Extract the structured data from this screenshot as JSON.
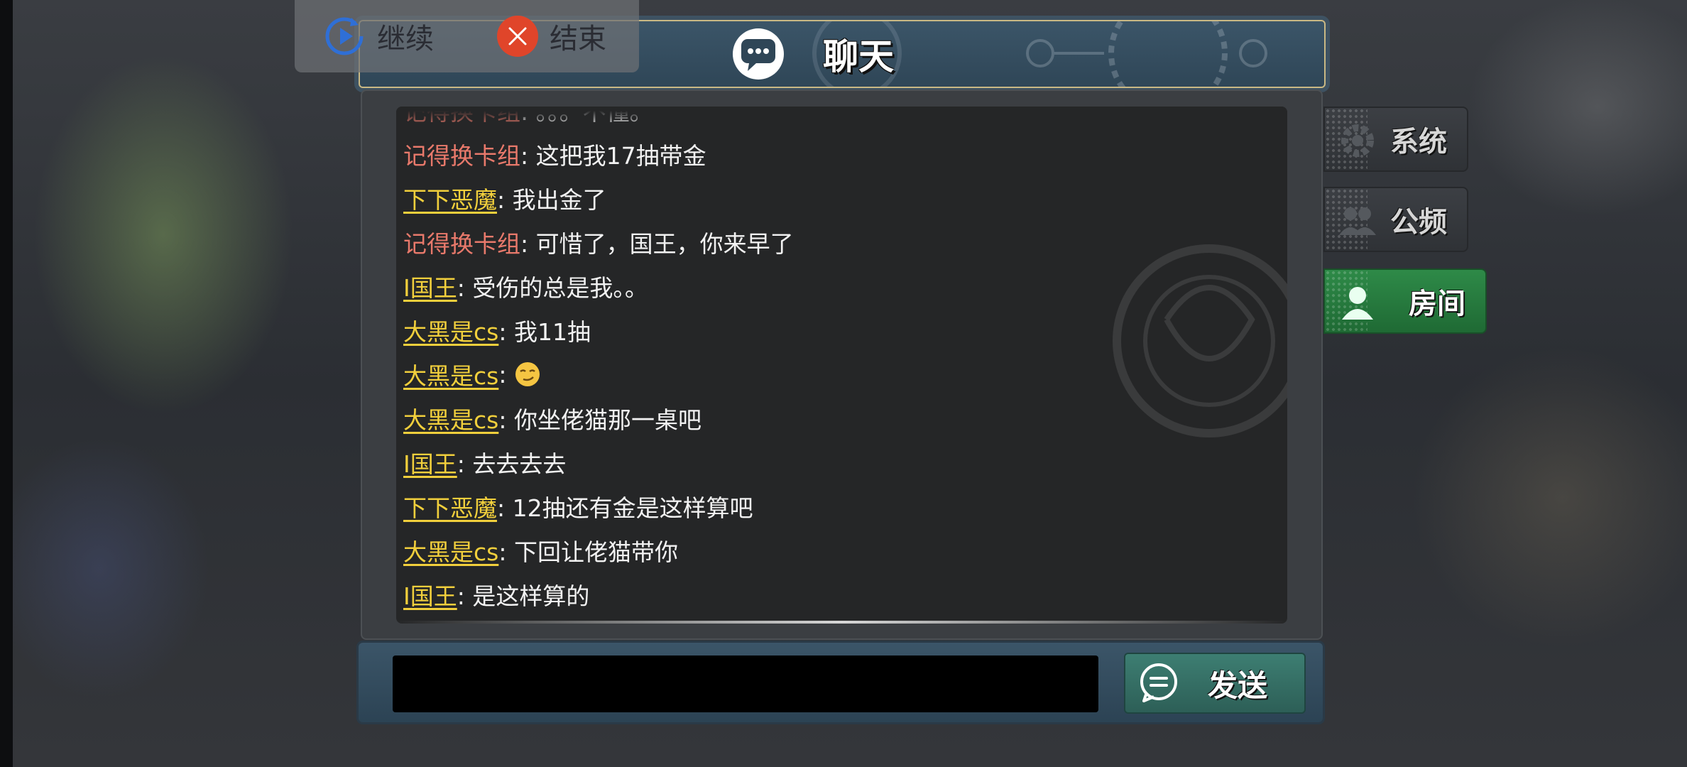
{
  "top_bar": {
    "continue_label": "继续",
    "end_label": "结束"
  },
  "header": {
    "title": "聊天"
  },
  "side_tabs": [
    {
      "label": "系统",
      "icon": "gear-icon",
      "active": false
    },
    {
      "label": "公频",
      "icon": "group-icon",
      "active": false
    },
    {
      "label": "房间",
      "icon": "person-icon",
      "active": true
    }
  ],
  "messages": [
    {
      "name": "记得换卡组",
      "text": ": 。。。不懂。",
      "name_style": "plain"
    },
    {
      "name": "记得换卡组",
      "text": ": 这把我17抽带金",
      "name_style": "plain"
    },
    {
      "name": "下下恶魔",
      "text": ": 我出金了",
      "name_style": "link"
    },
    {
      "name": "记得换卡组",
      "text": ": 可惜了，国王，你来早了",
      "name_style": "plain"
    },
    {
      "name": "I国王",
      "text": ": 受伤的总是我。。",
      "name_style": "link"
    },
    {
      "name": "大黑是cs",
      "text": ": 我11抽",
      "name_style": "link"
    },
    {
      "name": "大黑是cs",
      "text": ": ",
      "name_style": "link",
      "emoji": "smirk-emoji-icon"
    },
    {
      "name": "大黑是cs",
      "text": ": 你坐佬猫那一桌吧",
      "name_style": "link"
    },
    {
      "name": "I国王",
      "text": ": 去去去去",
      "name_style": "link"
    },
    {
      "name": "下下恶魔",
      "text": ": 12抽还有金是这样算吧",
      "name_style": "link"
    },
    {
      "name": "大黑是cs",
      "text": ": 下回让佬猫带你",
      "name_style": "link"
    },
    {
      "name": "I国王",
      "text": ": 是这样算的",
      "name_style": "link"
    }
  ],
  "input": {
    "value": "",
    "placeholder": ""
  },
  "send_button": {
    "label": "发送"
  },
  "colors": {
    "name_plain": "#e8796b",
    "name_link": "#f1cf3c",
    "room_tab": "#2e8a48",
    "close": "#e0452a"
  }
}
